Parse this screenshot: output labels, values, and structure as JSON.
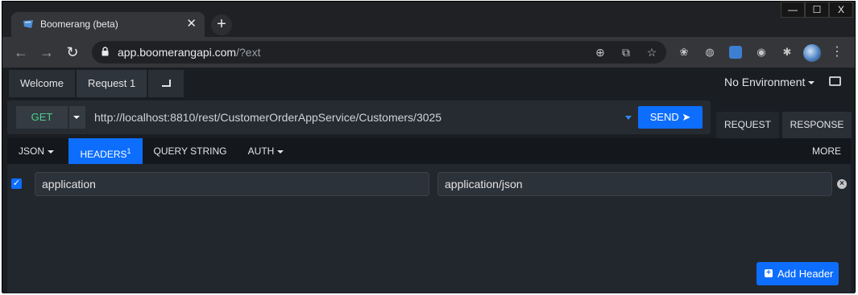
{
  "browser": {
    "tab_title": "Boomerang (beta)",
    "tab_close": "✕",
    "new_tab": "+",
    "window_controls": {
      "minimize": "—",
      "maximize": "☐",
      "close": "X"
    },
    "url_host": "app.boomerangapi.com",
    "url_rest": "/?ext"
  },
  "app": {
    "tabs": [
      {
        "label": "Welcome"
      },
      {
        "label": "Request 1"
      }
    ],
    "environment": "No Environment",
    "method": "GET",
    "request_url": "http://localhost:8810/rest/CustomerOrderAppService/Customers/3025",
    "send_label": "SEND ➤",
    "response_tabs": {
      "request": "REQUEST",
      "response": "RESPONSE"
    },
    "subtabs": {
      "json": "JSON",
      "headers": "HEADERS",
      "headers_count": "1",
      "query": "QUERY STRING",
      "auth": "AUTH",
      "more": "MORE"
    },
    "header_row": {
      "key": "application",
      "value": "application/json",
      "checked": true
    },
    "add_header_label": "Add Header"
  },
  "colors": {
    "accent": "#0d6efd",
    "method_get": "#4ad18e"
  }
}
